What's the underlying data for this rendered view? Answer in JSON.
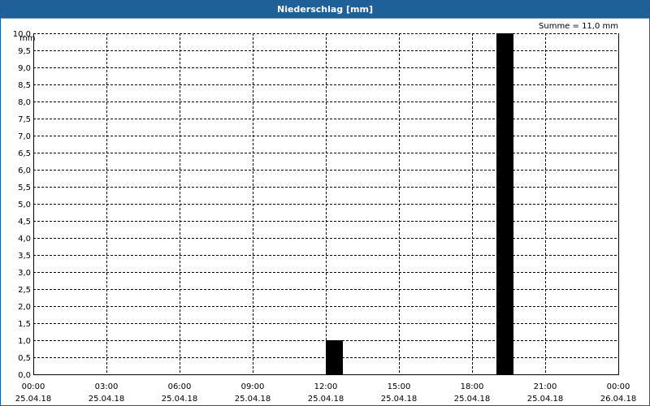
{
  "window": {
    "title": "Niederschlag [mm]"
  },
  "summary": "Summe = 11,0 mm",
  "colors": {
    "titlebar": "#1f6099",
    "bar": "#000000",
    "grid": "#000000"
  },
  "chart_data": {
    "type": "bar",
    "title": "Niederschlag [mm]",
    "ylabel": "mm",
    "ylim": [
      0,
      10
    ],
    "ystep": 0.5,
    "ytick_labels": [
      "0,0",
      "0,5",
      "1,0",
      "1,5",
      "2,0",
      "2,5",
      "3,0",
      "3,5",
      "4,0",
      "4,5",
      "5,0",
      "5,5",
      "6,0",
      "6,5",
      "7,0",
      "7,5",
      "8,0",
      "8,5",
      "9,0",
      "9,5",
      "10,0"
    ],
    "xlim_hours": [
      0,
      24
    ],
    "xticks": [
      {
        "hour": 0,
        "time": "00:00",
        "date": "25.04.18"
      },
      {
        "hour": 3,
        "time": "03:00",
        "date": "25.04.18"
      },
      {
        "hour": 6,
        "time": "06:00",
        "date": "25.04.18"
      },
      {
        "hour": 9,
        "time": "09:00",
        "date": "25.04.18"
      },
      {
        "hour": 12,
        "time": "12:00",
        "date": "25.04.18"
      },
      {
        "hour": 15,
        "time": "15:00",
        "date": "25.04.18"
      },
      {
        "hour": 18,
        "time": "18:00",
        "date": "25.04.18"
      },
      {
        "hour": 21,
        "time": "21:00",
        "date": "25.04.18"
      },
      {
        "hour": 24,
        "time": "00:00",
        "date": "26.04.18"
      }
    ],
    "bars": [
      {
        "start_hour": 12.0,
        "end_hour": 12.7,
        "value": 1.0
      },
      {
        "start_hour": 19.0,
        "end_hour": 19.7,
        "value": 10.0
      }
    ],
    "grid": true
  }
}
